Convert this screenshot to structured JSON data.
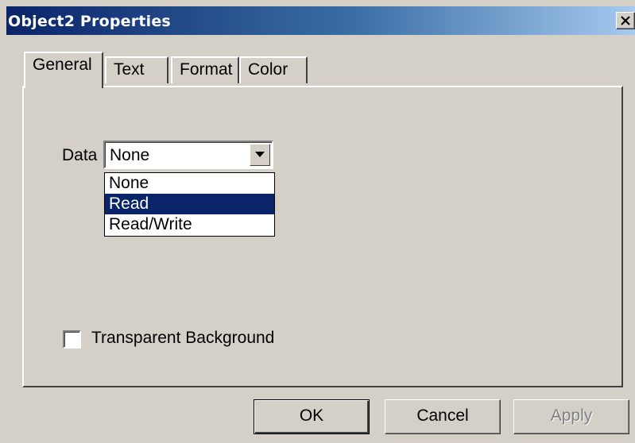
{
  "window": {
    "title": "Object2 Properties",
    "close_icon": "close-icon"
  },
  "tabs": [
    {
      "label": "General",
      "active": true
    },
    {
      "label": "Text",
      "active": false
    },
    {
      "label": "Format",
      "active": false
    },
    {
      "label": "Color",
      "active": false
    }
  ],
  "general": {
    "data_label": "Data",
    "data_value": "None",
    "data_options": [
      "None",
      "Read",
      "Read/Write"
    ],
    "highlighted_option": "Read",
    "transparent_label": "Transparent Background",
    "transparent_checked": false
  },
  "buttons": {
    "ok": "OK",
    "cancel": "Cancel",
    "apply": "Apply"
  },
  "colors": {
    "titlebar_start": "#0a246a",
    "titlebar_end": "#a6caf0",
    "face": "#d4d0c8",
    "selection": "#0a246a"
  }
}
